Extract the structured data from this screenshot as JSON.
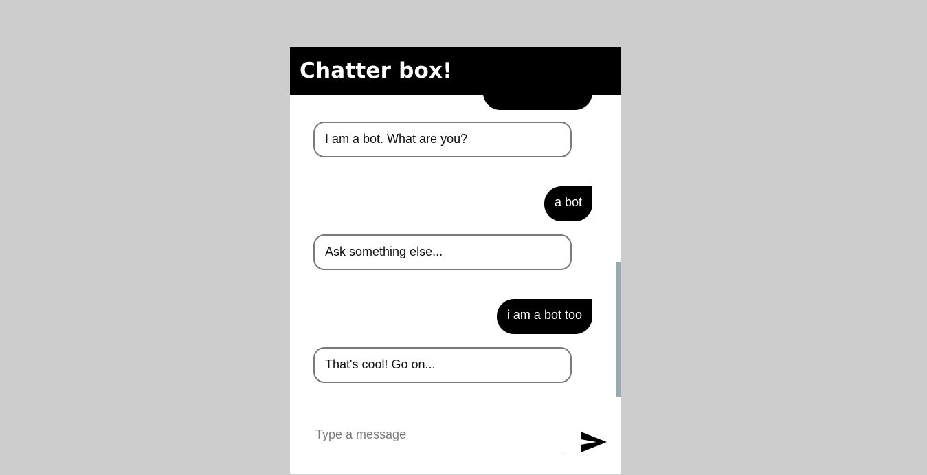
{
  "header": {
    "title": "Chatter box!"
  },
  "messages": [
    {
      "sender": "user",
      "text": ""
    },
    {
      "sender": "bot",
      "text": "I am a bot. What are you?"
    },
    {
      "sender": "user",
      "text": "a bot"
    },
    {
      "sender": "bot",
      "text": "Ask something else..."
    },
    {
      "sender": "user",
      "text": "i am a bot too"
    },
    {
      "sender": "bot",
      "text": "That's cool! Go on..."
    }
  ],
  "composer": {
    "placeholder": "Type a message",
    "value": ""
  },
  "icons": {
    "send": "send-arrow-icon"
  },
  "colors": {
    "page_background": "#cdcdcd",
    "header_background": "#000000",
    "user_bubble": "#000000",
    "bot_border": "#7a7a7a",
    "scrollbar_thumb": "#9aa8b0"
  }
}
